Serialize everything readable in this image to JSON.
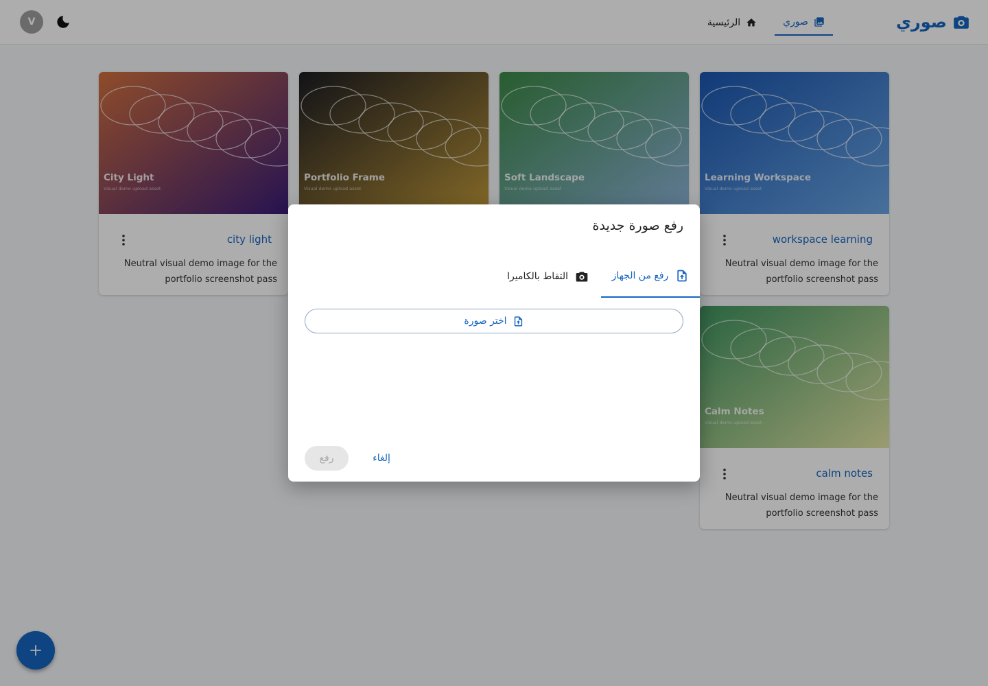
{
  "appbar": {
    "brand": "صوري",
    "nav": [
      {
        "label": "صوري",
        "icon": "photo-library-icon",
        "active": true
      },
      {
        "label": "الرئيسية",
        "icon": "home-icon",
        "active": false
      }
    ],
    "avatar_initial": "V"
  },
  "cards": [
    {
      "media_title": "City Light",
      "media_subtitle": "Visual demo upload asset",
      "title": "city light",
      "description": "Neutral visual demo image for the portfolio screenshot pass",
      "gradient": [
        "#d2703e",
        "#3a1d78"
      ]
    },
    {
      "media_title": "Portfolio Frame",
      "media_subtitle": "Visual demo upload asset",
      "title": "",
      "description": "",
      "gradient": [
        "#1c1c22",
        "#c29a3a"
      ]
    },
    {
      "media_title": "Soft Landscape",
      "media_subtitle": "Visual demo upload asset",
      "title": "",
      "description": "",
      "gradient": [
        "#3c8a46",
        "#8fb4dc"
      ]
    },
    {
      "media_title": "Learning Workspace",
      "media_subtitle": "Visual demo upload asset",
      "title": "workspace learning",
      "description": "Neutral visual demo image for the portfolio screenshot pass",
      "gradient": [
        "#1a56b0",
        "#6aa5e4"
      ]
    },
    {
      "media_title": "Calm Notes",
      "media_subtitle": "Visual demo upload asset",
      "title": "calm notes",
      "description": "Neutral visual demo image for the portfolio screenshot pass",
      "gradient": [
        "#3e9460",
        "#e4e6a6"
      ]
    }
  ],
  "dialog": {
    "title": "رفع صورة جديدة",
    "tabs": [
      {
        "label": "رفع من الجهاز",
        "icon": "upload-file-icon",
        "active": true
      },
      {
        "label": "التقاط بالكاميرا",
        "icon": "camera-icon",
        "active": false
      }
    ],
    "pick_button": "اختر صورة",
    "cancel_button": "إلغاء",
    "upload_button": "رفع"
  },
  "colors": {
    "primary": "#1565c0",
    "scrim": "rgba(0,0,0,0.32)",
    "avatar": "#9e9e9e"
  }
}
